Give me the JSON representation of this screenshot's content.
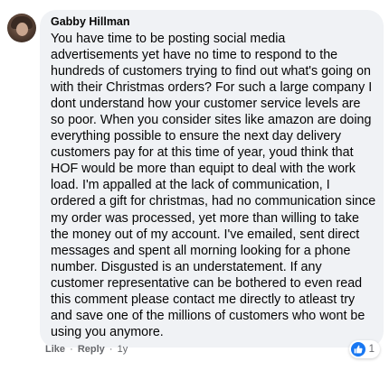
{
  "comment": {
    "author": "Gabby Hillman",
    "text": "You have time to be posting social media advertisements yet have no time to respond to the hundreds of customers trying to find out what's going on with their Christmas orders? For such a large company I dont understand how your customer service levels are so poor. When you consider sites like amazon are doing everything possible to ensure the next day delivery customers pay for at this time of year, youd think that HOF would be more than equipt to deal with the work load. I'm appalled at the lack of communication, I ordered a gift for christmas, had no communication since my order was processed, yet more than willing to take the money out of my account. I've emailed, sent direct messages and spent all morning looking for a phone number. Disgusted is an understatement. If any customer representative can be bothered to even read this comment please contact me directly to atleast try and save one of the millions of customers who wont be using you anymore.",
    "reaction_icon": "like-icon",
    "reaction_count": "1"
  },
  "actions": {
    "like_label": "Like",
    "separator": "·",
    "reply_label": "Reply",
    "timestamp": "1y"
  },
  "colors": {
    "bubble_bg": "#f0f2f5",
    "like_blue": "#1877f2",
    "meta_gray": "#65676b"
  }
}
